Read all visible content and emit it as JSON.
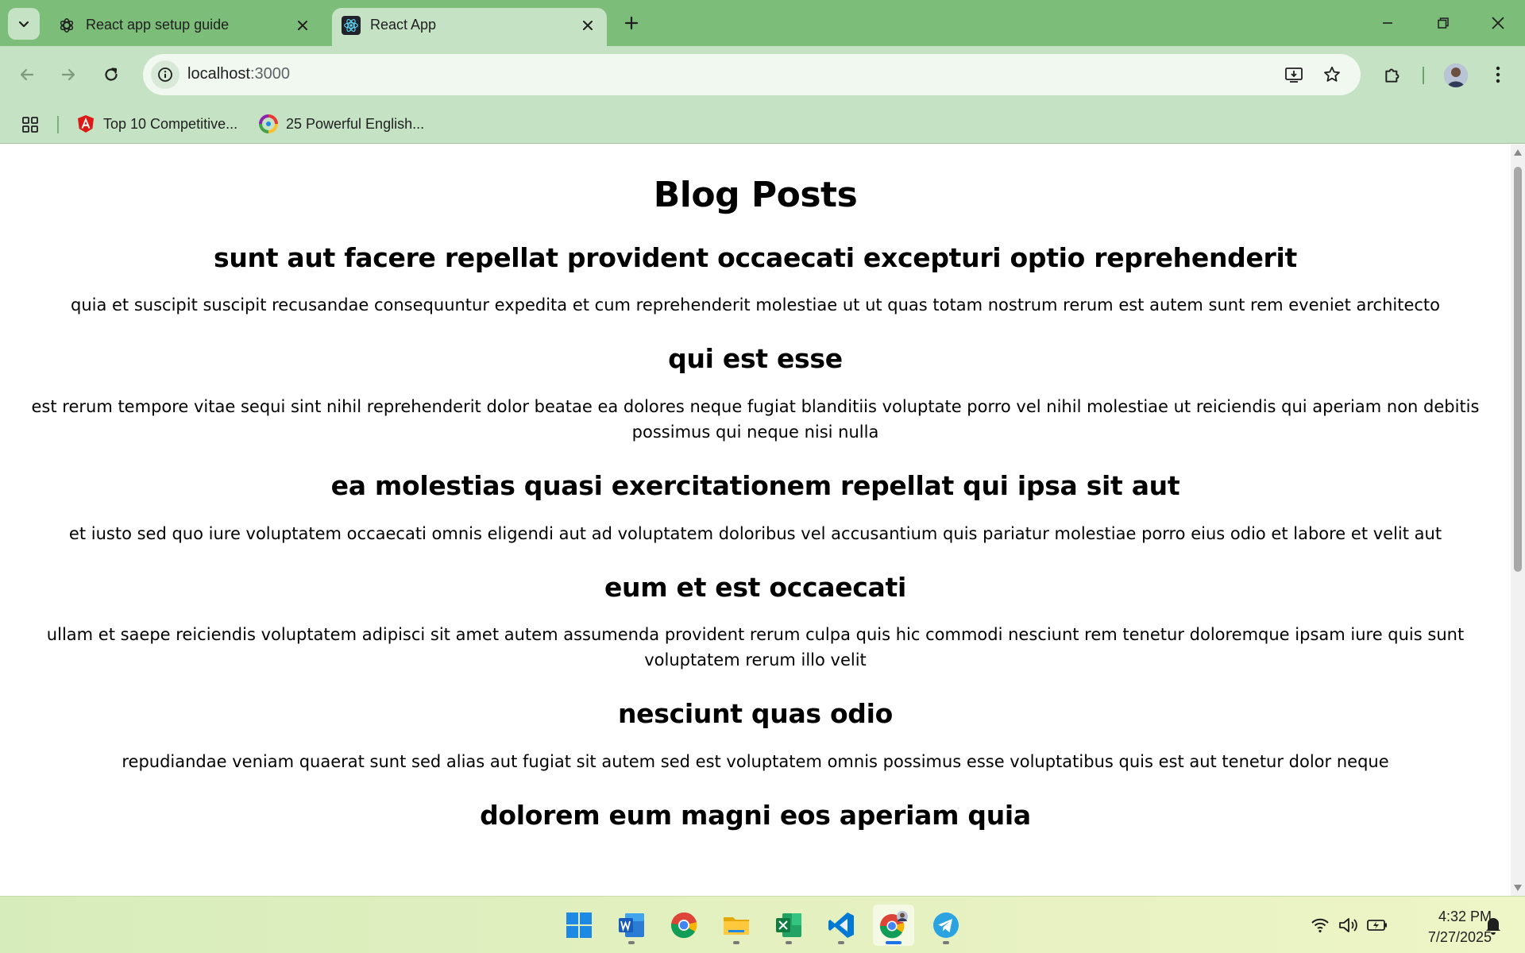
{
  "browser": {
    "tabs": [
      {
        "title": "React app setup guide",
        "active": false,
        "favicon": "chatgpt-icon"
      },
      {
        "title": "React App",
        "active": true,
        "favicon": "react-icon"
      }
    ],
    "address": {
      "host": "localhost",
      "path": ":3000"
    },
    "bookmarks": [
      {
        "label": "Top 10 Competitive...",
        "icon": "angular-icon"
      },
      {
        "label": "25 Powerful English...",
        "icon": "colorful-logo-icon"
      }
    ]
  },
  "page": {
    "heading": "Blog Posts",
    "posts": [
      {
        "title": "sunt aut facere repellat provident occaecati excepturi optio reprehenderit",
        "body": "quia et suscipit suscipit recusandae consequuntur expedita et cum reprehenderit molestiae ut ut quas totam nostrum rerum est autem sunt rem eveniet architecto"
      },
      {
        "title": "qui est esse",
        "body": "est rerum tempore vitae sequi sint nihil reprehenderit dolor beatae ea dolores neque fugiat blanditiis voluptate porro vel nihil molestiae ut reiciendis qui aperiam non debitis possimus qui neque nisi nulla"
      },
      {
        "title": "ea molestias quasi exercitationem repellat qui ipsa sit aut",
        "body": "et iusto sed quo iure voluptatem occaecati omnis eligendi aut ad voluptatem doloribus vel accusantium quis pariatur molestiae porro eius odio et labore et velit aut"
      },
      {
        "title": "eum et est occaecati",
        "body": "ullam et saepe reiciendis voluptatem adipisci sit amet autem assumenda provident rerum culpa quis hic commodi nesciunt rem tenetur doloremque ipsam iure quis sunt voluptatem rerum illo velit"
      },
      {
        "title": "nesciunt quas odio",
        "body": "repudiandae veniam quaerat sunt sed alias aut fugiat sit autem sed est voluptatem omnis possimus esse voluptatibus quis est aut tenetur dolor neque"
      },
      {
        "title": "dolorem eum magni eos aperiam quia",
        "body": ""
      }
    ]
  },
  "taskbar": {
    "apps": [
      "windows-start-icon",
      "word-icon",
      "chrome-icon",
      "file-explorer-icon",
      "excel-icon",
      "vscode-icon",
      "chrome-profile-icon",
      "telegram-icon"
    ],
    "time": "4:32 PM",
    "date": "7/27/2025"
  },
  "colors": {
    "tabstrip": "#7cbd7a",
    "toolbar": "#c5e3c4",
    "omnibox": "#f1f8f0",
    "taskbar_start": "#d7ecbb",
    "taskbar_end": "#eef5c6"
  }
}
